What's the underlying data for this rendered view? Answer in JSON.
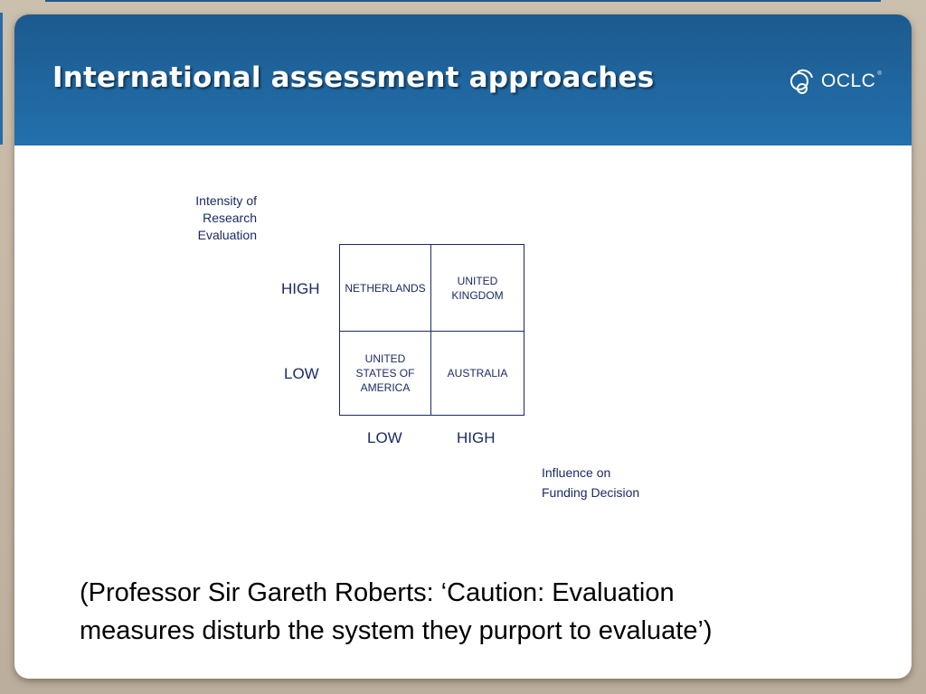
{
  "slide": {
    "title": "International assessment approaches",
    "logo": {
      "text": "OCLC",
      "mark": "oclc-logo-icon",
      "superscript": "®"
    }
  },
  "diagram": {
    "y_axis_title": [
      "Intensity of",
      "Research",
      "Evaluation"
    ],
    "x_axis_title": [
      "Influence on",
      "Funding Decision"
    ],
    "y_ticks": [
      "HIGH",
      "LOW"
    ],
    "x_ticks": [
      "LOW",
      "HIGH"
    ],
    "cells": {
      "high_low": [
        "NETHERLANDS"
      ],
      "high_high": [
        "UNITED",
        "KINGDOM"
      ],
      "low_low": [
        "UNITED",
        "STATES OF",
        "AMERICA"
      ],
      "low_high": [
        "AUSTRALIA"
      ]
    }
  },
  "quote": {
    "line1": "(Professor Sir Gareth Roberts: ‘Caution: Evaluation",
    "line2": "measures disturb the system they purport to evaluate’)"
  },
  "colors": {
    "header_top": "#1c5a8e",
    "header_bottom": "#2370ad",
    "diagram_ink": "#1b2a64",
    "frame": "#c6b9a6"
  }
}
